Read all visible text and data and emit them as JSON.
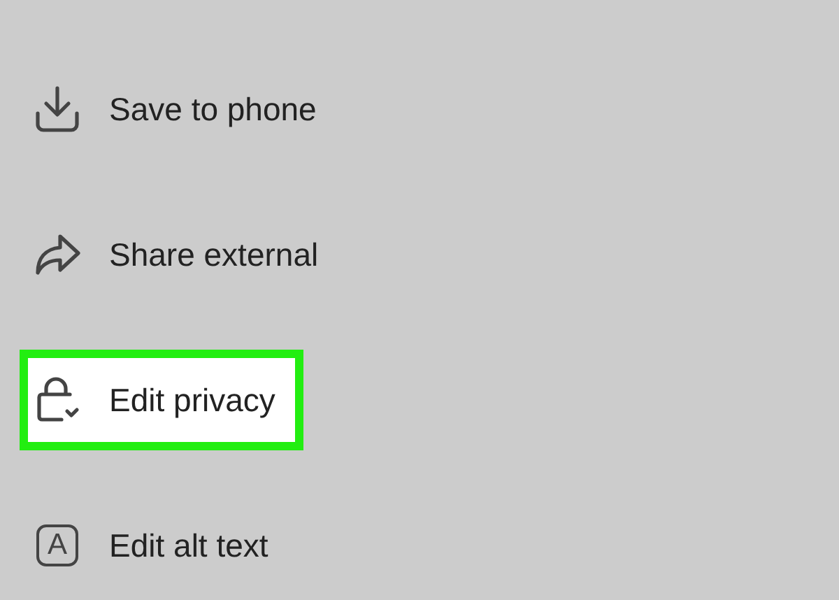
{
  "menu": {
    "items": [
      {
        "kind": "download",
        "label": "Save to phone",
        "highlighted": false
      },
      {
        "kind": "share",
        "label": "Share external",
        "highlighted": false
      },
      {
        "kind": "lock",
        "label": "Edit privacy",
        "highlighted": true
      },
      {
        "kind": "alt-text",
        "label": "Edit alt text",
        "icon_text": "A",
        "highlighted": false
      }
    ]
  }
}
